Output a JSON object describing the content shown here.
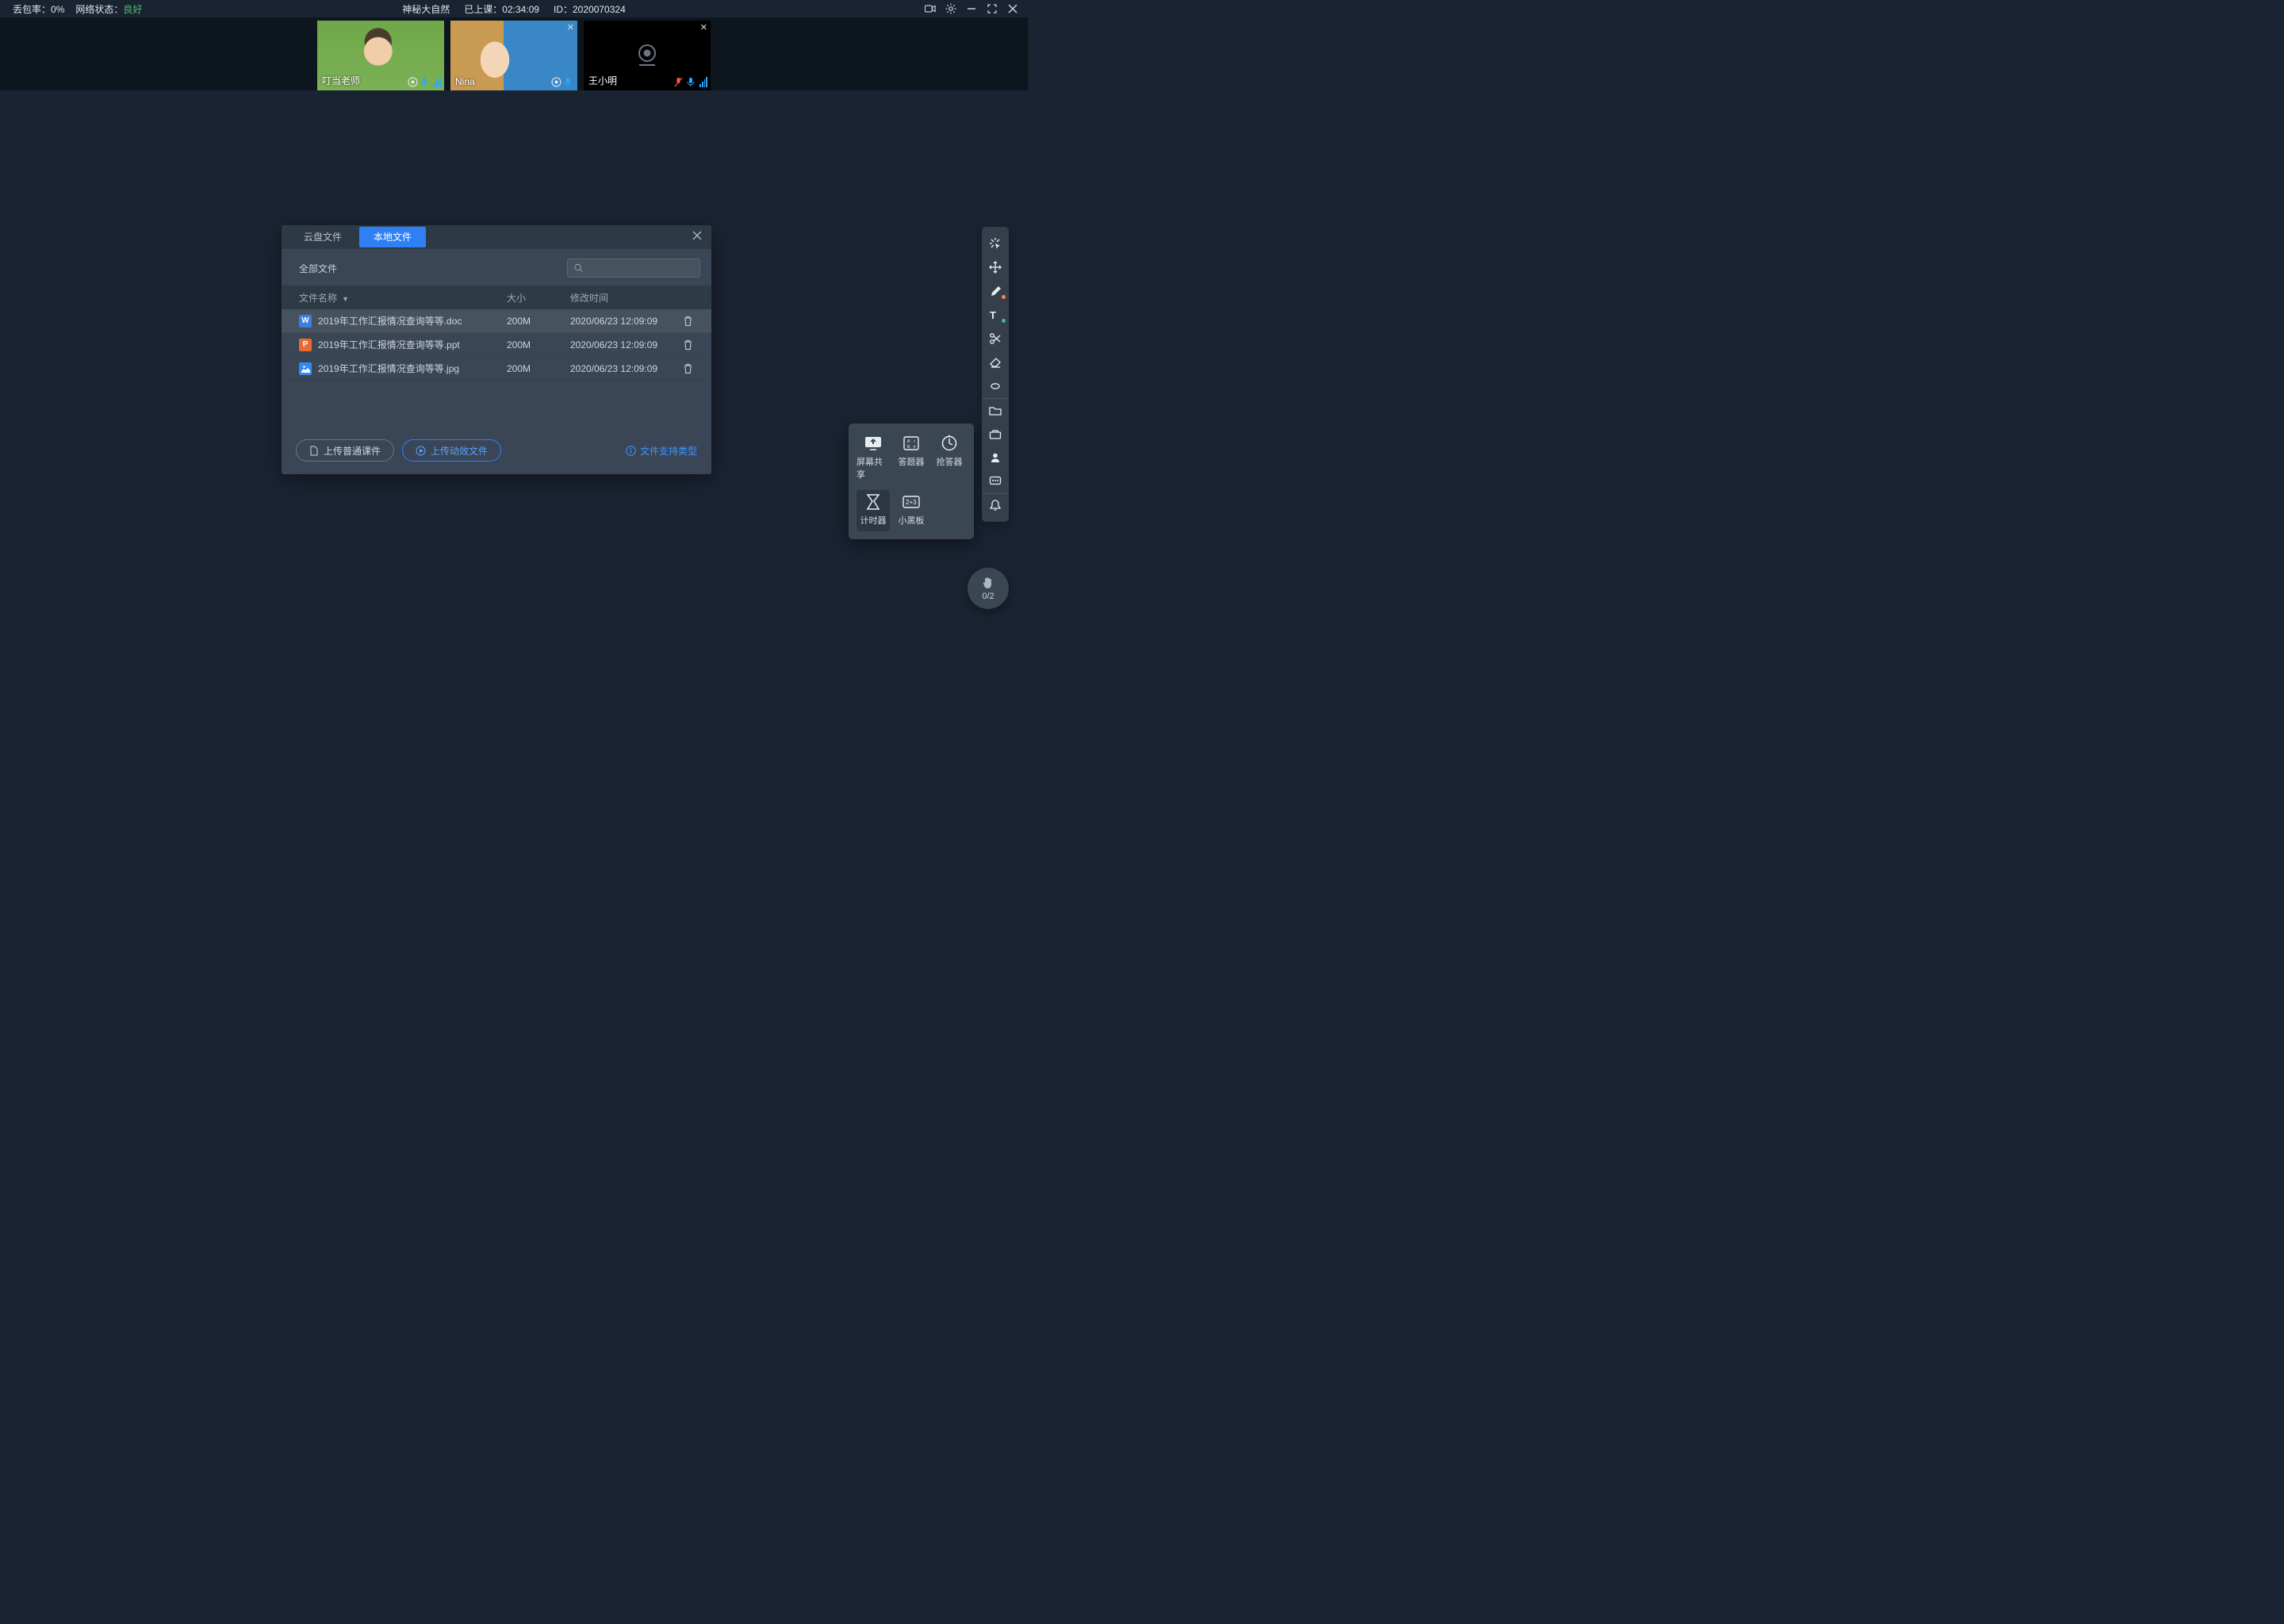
{
  "topbar": {
    "packet_loss_label": "丢包率：",
    "packet_loss_value": "0%",
    "net_label": "网络状态：",
    "net_value": "良好",
    "title": "神秘大自然",
    "elapsed_label": "已上课：",
    "elapsed_value": "02:34:09",
    "id_label": "ID：",
    "id_value": "2020070324"
  },
  "participants": [
    {
      "name": "叮当老师",
      "camera": true,
      "style": "a",
      "closeable": false,
      "levels": true
    },
    {
      "name": "Nina",
      "camera": true,
      "style": "b",
      "closeable": true,
      "levels": false
    },
    {
      "name": "王小明",
      "camera": false,
      "style": "",
      "closeable": true,
      "levels": true
    }
  ],
  "file_dialog": {
    "tabs": {
      "cloud": "云盘文件",
      "local": "本地文件"
    },
    "all_files": "全部文件",
    "columns": {
      "name": "文件名称",
      "size": "大小",
      "mtime": "修改时间"
    },
    "rows": [
      {
        "type": "doc",
        "badge": "W",
        "name": "2019年工作汇报情况查询等等.doc",
        "size": "200M",
        "mtime": "2020/06/23 12:09:09",
        "selected": true
      },
      {
        "type": "ppt",
        "badge": "P",
        "name": "2019年工作汇报情况查询等等.ppt",
        "size": "200M",
        "mtime": "2020/06/23 12:09:09",
        "selected": false
      },
      {
        "type": "jpg",
        "badge": "",
        "name": "2019年工作汇报情况查询等等.jpg",
        "size": "200M",
        "mtime": "2020/06/23 12:09:09",
        "selected": false
      }
    ],
    "upload_normal": "上传普通课件",
    "upload_anim": "上传动效文件",
    "support_link": "文件支持类型"
  },
  "tools_pop": [
    {
      "id": "screen-share",
      "label": "屏幕共享"
    },
    {
      "id": "quiz",
      "label": "答题器"
    },
    {
      "id": "buzzer",
      "label": "抢答器"
    },
    {
      "id": "timer",
      "label": "计时器",
      "active": true
    },
    {
      "id": "blackboard",
      "label": "小黑板"
    }
  ],
  "right_toolbar": [
    {
      "id": "laser"
    },
    {
      "id": "move"
    },
    {
      "id": "pen",
      "accent": "orange"
    },
    {
      "id": "text",
      "accent": "teal"
    },
    {
      "id": "scissors"
    },
    {
      "id": "eraser"
    },
    {
      "id": "dot"
    },
    {
      "id": "folder",
      "sep": true
    },
    {
      "id": "toolbox"
    },
    {
      "id": "person"
    },
    {
      "id": "chat"
    },
    {
      "id": "bell",
      "sep": true
    }
  ],
  "hand": {
    "count": "0/2"
  }
}
